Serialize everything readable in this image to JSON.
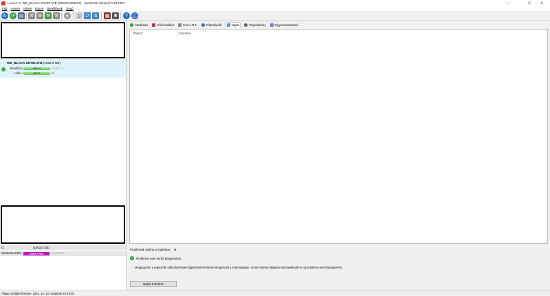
{
  "window": {
    "title": "Lemez: 2, WD_BLACK  SN750 2TB [20530C303537]  -  Hard Disk Sentinel 5.60 PRO",
    "minimize": "–",
    "maximize": "☐",
    "close": "✕"
  },
  "menu": [
    "Fájl",
    "Lemez",
    "Nézet",
    "Riport",
    "Beállítások",
    "Súgó"
  ],
  "disk": {
    "name": "WD_BLACK  SN750 2TB",
    "size": "(1863,0 GB)",
    "condition_label": "Kondíció:",
    "condition_value": "100 %",
    "condition_fraction": 1.0,
    "condition_extra": "Lemez: 2",
    "temp_label": "Hőm.:",
    "temp_value": "35 °C",
    "temp_extra": "IO",
    "status_color": "#2aa135"
  },
  "volume": {
    "letter": "G:",
    "size": "(1863,0 GB)",
    "free_label": "Szabad terület:",
    "free_value": "1862,9 GB",
    "free_extra": "Lemez: 2",
    "free_color": "#b81db8"
  },
  "tabs": [
    {
      "label": "Áttekintés",
      "icon": "check-circle-icon",
      "color": "#2aa135"
    },
    {
      "label": "Hőmérséklet",
      "icon": "thermometer-icon",
      "color": "#c0392b"
    },
    {
      "label": "S.M.A.R.T.",
      "icon": "smart-icon",
      "color": "#888"
    },
    {
      "label": "Információk",
      "icon": "info-icon",
      "color": "#2a6fc9"
    },
    {
      "label": "Napló",
      "icon": "log-icon",
      "color": "#5a8fd6"
    },
    {
      "label": "Teljesítmény",
      "icon": "performance-icon",
      "color": "#2e7d32"
    },
    {
      "label": "Figyelmeztetések",
      "icon": "alerts-icon",
      "color": "#7a7ad6"
    }
  ],
  "log": {
    "col_time": "Időpont",
    "col_event": "Esemény",
    "problem_count_label": "Problémák száma a naplóban:",
    "problem_count": "0",
    "no_problem": "Probléma nem került bejegyzésre.",
    "description": "Megjegyzés: a regisztrált változást képes figyelmeztetni illetve lekapcsolni a számítógépet, amint a lemez állapota visszaesikodik és új probléma kerül bejegyzésre.",
    "clear_button": "Napló Kiürítése"
  },
  "status": "Állapot utoljára frissítve: 2024. 10. 10. csütörtök 10:19:30"
}
